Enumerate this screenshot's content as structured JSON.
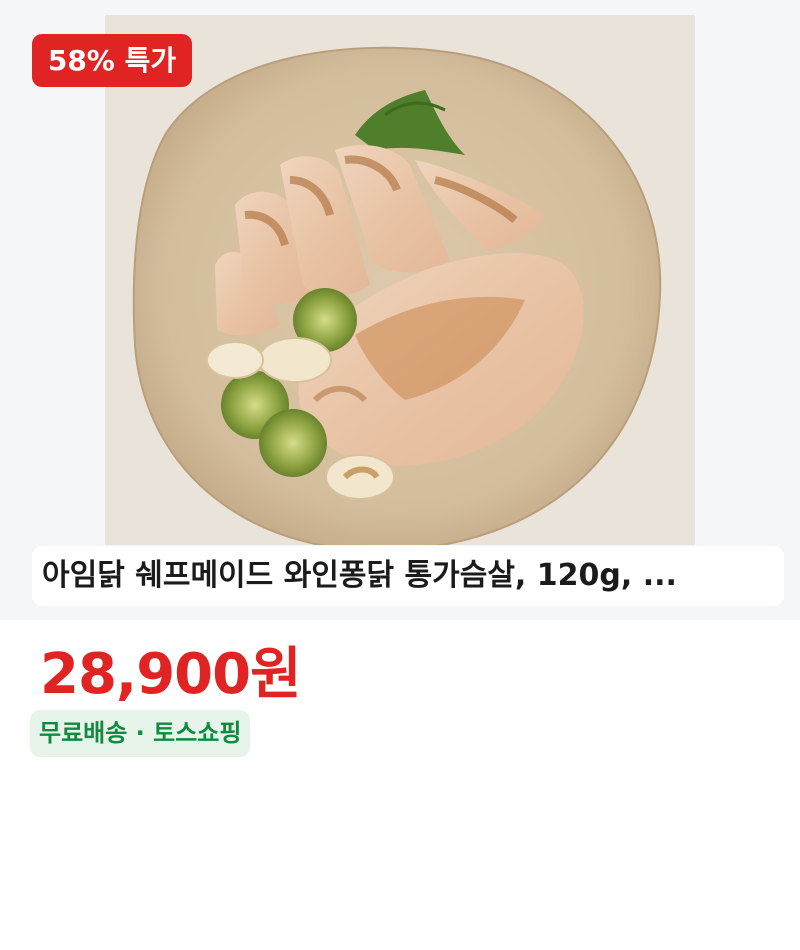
{
  "product": {
    "badge": "58% 특가",
    "title": "아임닭 쉐프메이드 와인퐁닭 통가슴살, 120g, ...",
    "price": "28,900원",
    "shipping": "무료배송 · 토스쇼핑",
    "image_icon": "product-photo-chicken-breast"
  },
  "colors": {
    "badge_bg": "#e02424",
    "price": "#e02424",
    "shipping_text": "#0f8a3e",
    "shipping_bg": "#e6f4ea",
    "hero_bg": "#f5f6f8"
  }
}
